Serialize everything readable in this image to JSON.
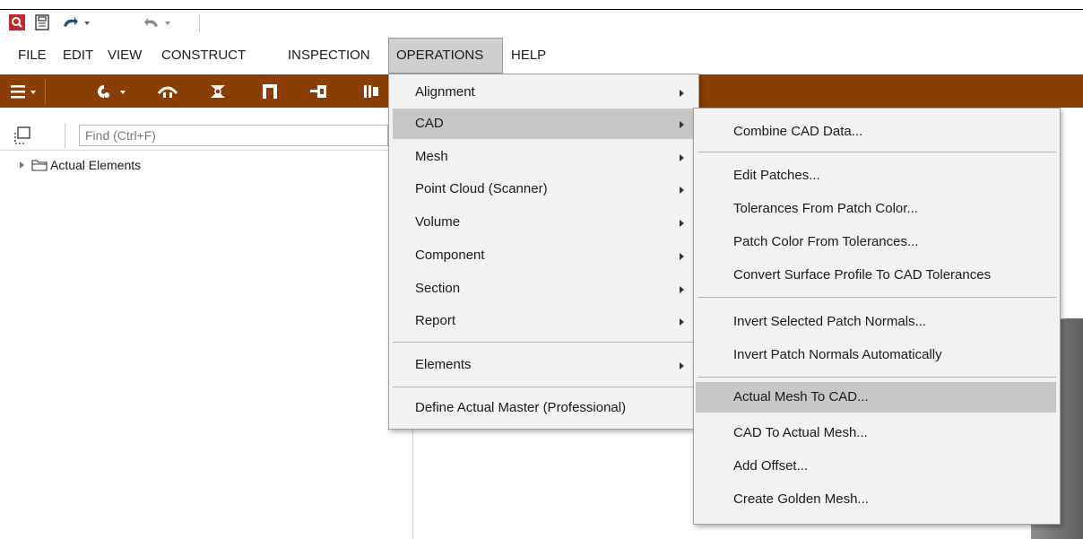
{
  "title_fragment": "",
  "menubar": {
    "items": [
      {
        "label": "FILE"
      },
      {
        "label": "EDIT"
      },
      {
        "label": "VIEW"
      },
      {
        "label": "CONSTRUCT"
      },
      {
        "label": "INSPECTION"
      },
      {
        "label": "OPERATIONS",
        "active": true
      },
      {
        "label": "HELP"
      }
    ]
  },
  "explorer": {
    "find_placeholder": "Find (Ctrl+F)",
    "tree_root": "Actual Elements"
  },
  "operations_menu": {
    "items": [
      {
        "label": "Alignment",
        "submenu": true
      },
      {
        "label": "CAD",
        "submenu": true,
        "highlighted": true
      },
      {
        "label": "Mesh",
        "submenu": true
      },
      {
        "label": "Point Cloud (Scanner)",
        "submenu": true
      },
      {
        "label": "Volume",
        "submenu": true
      },
      {
        "label": "Component",
        "submenu": true
      },
      {
        "label": "Section",
        "submenu": true
      },
      {
        "label": "Report",
        "submenu": true
      },
      {
        "label": "Elements",
        "submenu": true
      },
      {
        "label": "Define Actual Master (Professional)",
        "submenu": false
      }
    ]
  },
  "cad_menu": {
    "items": [
      {
        "label": "Combine CAD Data..."
      },
      {
        "label": "Edit Patches..."
      },
      {
        "label": "Tolerances From Patch Color..."
      },
      {
        "label": "Patch Color From Tolerances..."
      },
      {
        "label": "Convert Surface Profile To CAD Tolerances"
      },
      {
        "label": "Invert Selected Patch Normals..."
      },
      {
        "label": "Invert Patch Normals Automatically"
      },
      {
        "label": "Actual Mesh To CAD...",
        "highlighted": true
      },
      {
        "label": "CAD To Actual Mesh..."
      },
      {
        "label": "Add Offset..."
      },
      {
        "label": "Create Golden Mesh..."
      }
    ]
  },
  "colors": {
    "toolbar": "#8a3e06",
    "app_icon": "#c0282e",
    "menu_highlight": "#c7c7c7"
  },
  "icons": [
    "app-search-icon",
    "save-icon",
    "undo-icon",
    "redo-icon",
    "hamburger-icon",
    "selection-icon",
    "folder-icon"
  ]
}
